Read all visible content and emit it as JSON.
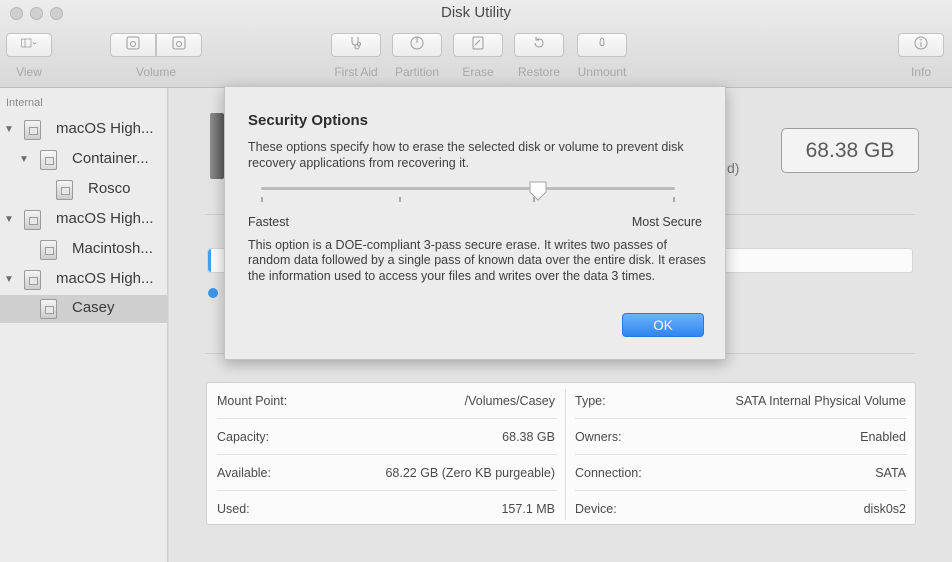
{
  "window": {
    "title": "Disk Utility"
  },
  "toolbar": {
    "view_label": "View",
    "volume_label": "Volume",
    "first_aid_label": "First Aid",
    "partition_label": "Partition",
    "erase_label": "Erase",
    "restore_label": "Restore",
    "unmount_label": "Unmount",
    "info_label": "Info"
  },
  "sidebar": {
    "section": "Internal",
    "items": [
      {
        "label": "macOS High..."
      },
      {
        "label": "Container..."
      },
      {
        "label": "Rosco"
      },
      {
        "label": "macOS High..."
      },
      {
        "label": "Macintosh..."
      },
      {
        "label": "macOS High..."
      },
      {
        "label": "Casey"
      }
    ]
  },
  "main": {
    "capacity": "68.38 GB",
    "paren": "d)",
    "info": {
      "left": [
        {
          "key": "Mount Point:",
          "value": "/Volumes/Casey"
        },
        {
          "key": "Capacity:",
          "value": "68.38 GB"
        },
        {
          "key": "Available:",
          "value": "68.22 GB (Zero KB purgeable)"
        },
        {
          "key": "Used:",
          "value": "157.1 MB"
        }
      ],
      "right": [
        {
          "key": "Type:",
          "value": "SATA Internal Physical Volume"
        },
        {
          "key": "Owners:",
          "value": "Enabled"
        },
        {
          "key": "Connection:",
          "value": "SATA"
        },
        {
          "key": "Device:",
          "value": "disk0s2"
        }
      ]
    }
  },
  "sheet": {
    "title": "Security Options",
    "description": "These options specify how to erase the selected disk or volume to prevent disk recovery applications from recovering it.",
    "slider_min_label": "Fastest",
    "slider_max_label": "Most Secure",
    "slider_level": 0.67,
    "body": "This option is a DOE-compliant 3-pass secure erase. It writes two passes of random data followed by a single pass of known data over the entire disk. It erases the information used to access your files and writes over the data 3 times.",
    "ok_label": "OK"
  },
  "colors": {
    "accent": "#3b8ff0",
    "selection": "#cfcfcf"
  }
}
